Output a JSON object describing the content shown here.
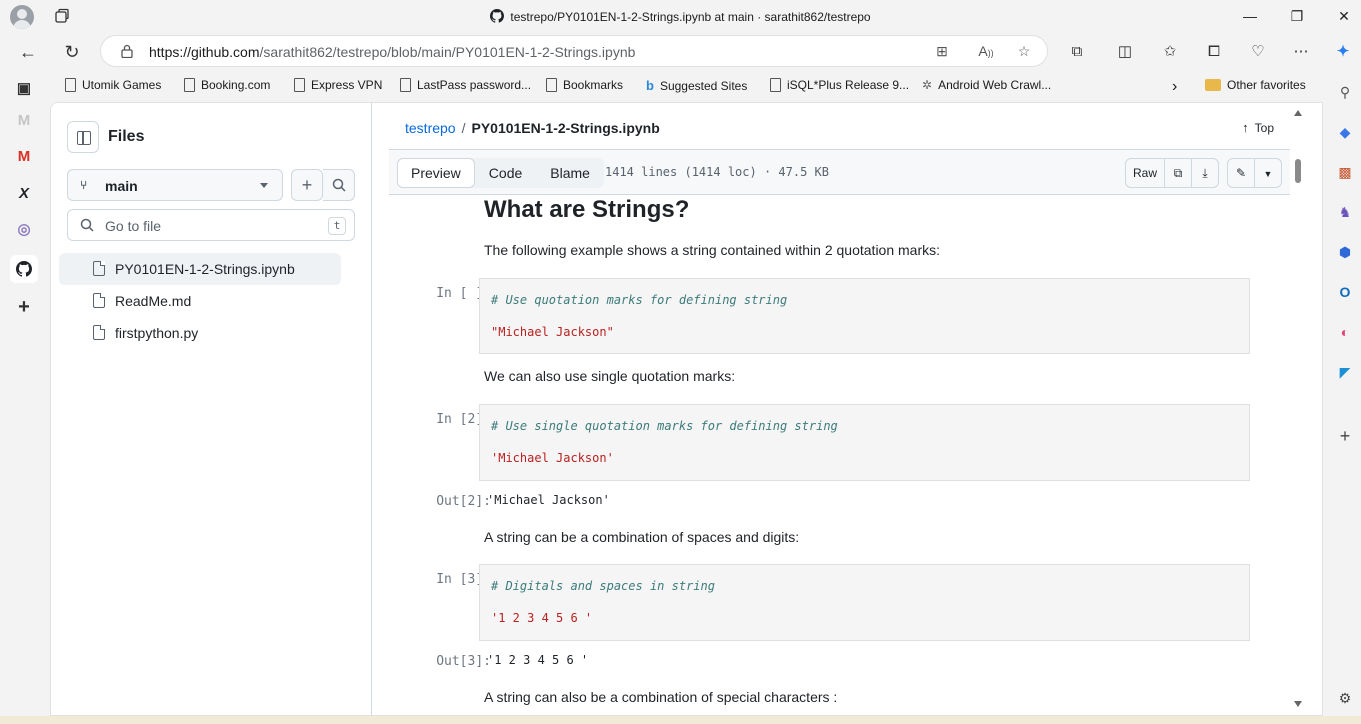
{
  "window": {
    "title": "testrepo/PY0101EN-1-2-Strings.ipynb at main · sarathit862/testrepo",
    "minimize": "—",
    "restore": "❐",
    "close": "✕"
  },
  "address": {
    "url_host": "https://github.com",
    "url_path": "/sarathit862/testrepo/blob/main/PY0101EN-1-2-Strings.ipynb"
  },
  "bookmarks": [
    {
      "label": "Utomik Games",
      "icon": "page-icon"
    },
    {
      "label": "Booking.com",
      "icon": "page-icon"
    },
    {
      "label": "Express VPN",
      "icon": "page-icon"
    },
    {
      "label": "LastPass password...",
      "icon": "page-icon"
    },
    {
      "label": "Bookmarks",
      "icon": "page-icon"
    },
    {
      "label": "Suggested Sites",
      "icon": "bing-icon"
    },
    {
      "label": "iSQL*Plus Release 9...",
      "icon": "page-icon"
    },
    {
      "label": "Android Web Crawl...",
      "icon": "crawler-icon"
    },
    {
      "label": "Other favorites",
      "icon": "folder-icon"
    }
  ],
  "sidebar": {
    "title": "Files",
    "branch": "main",
    "search_placeholder": "Go to file",
    "search_shortcut": "t",
    "files": [
      {
        "name": "PY0101EN-1-2-Strings.ipynb",
        "active": true
      },
      {
        "name": "ReadMe.md",
        "active": false
      },
      {
        "name": "firstpython.py",
        "active": false
      }
    ]
  },
  "breadcrumb": {
    "repo": "testrepo",
    "separator": "/",
    "file": "PY0101EN-1-2-Strings.ipynb",
    "top_label": "Top"
  },
  "fileheader": {
    "tabs": [
      "Preview",
      "Code",
      "Blame"
    ],
    "active_tab": "Preview",
    "info": "1414 lines (1414 loc) · 47.5 KB",
    "raw_label": "Raw"
  },
  "notebook": {
    "heading": "What are Strings?",
    "p1": "The following example shows a string contained within 2 quotation marks:",
    "cell1": {
      "prompt": "In [ ]:",
      "comment": "# Use quotation marks for defining string",
      "code": "\"Michael Jackson\""
    },
    "p2": "We can also use single quotation marks:",
    "cell2": {
      "prompt": "In [2]:",
      "comment": "# Use single quotation marks for defining string",
      "code": "'Michael Jackson'"
    },
    "out2": {
      "prompt": "Out[2]:",
      "value": "'Michael Jackson'"
    },
    "p3": "A string can be a combination of spaces and digits:",
    "cell3": {
      "prompt": "In [3]:",
      "comment": "# Digitals and spaces in string",
      "code": "'1 2 3 4 5 6 '"
    },
    "out3": {
      "prompt": "Out[3]:",
      "value": "'1 2 3 4 5 6 '"
    },
    "p4": "A string can also be a combination of special characters :"
  },
  "colors": {
    "link": "#0969da",
    "comment": "#3d7b7b",
    "string": "#ba2121",
    "border": "#d0d7de"
  }
}
